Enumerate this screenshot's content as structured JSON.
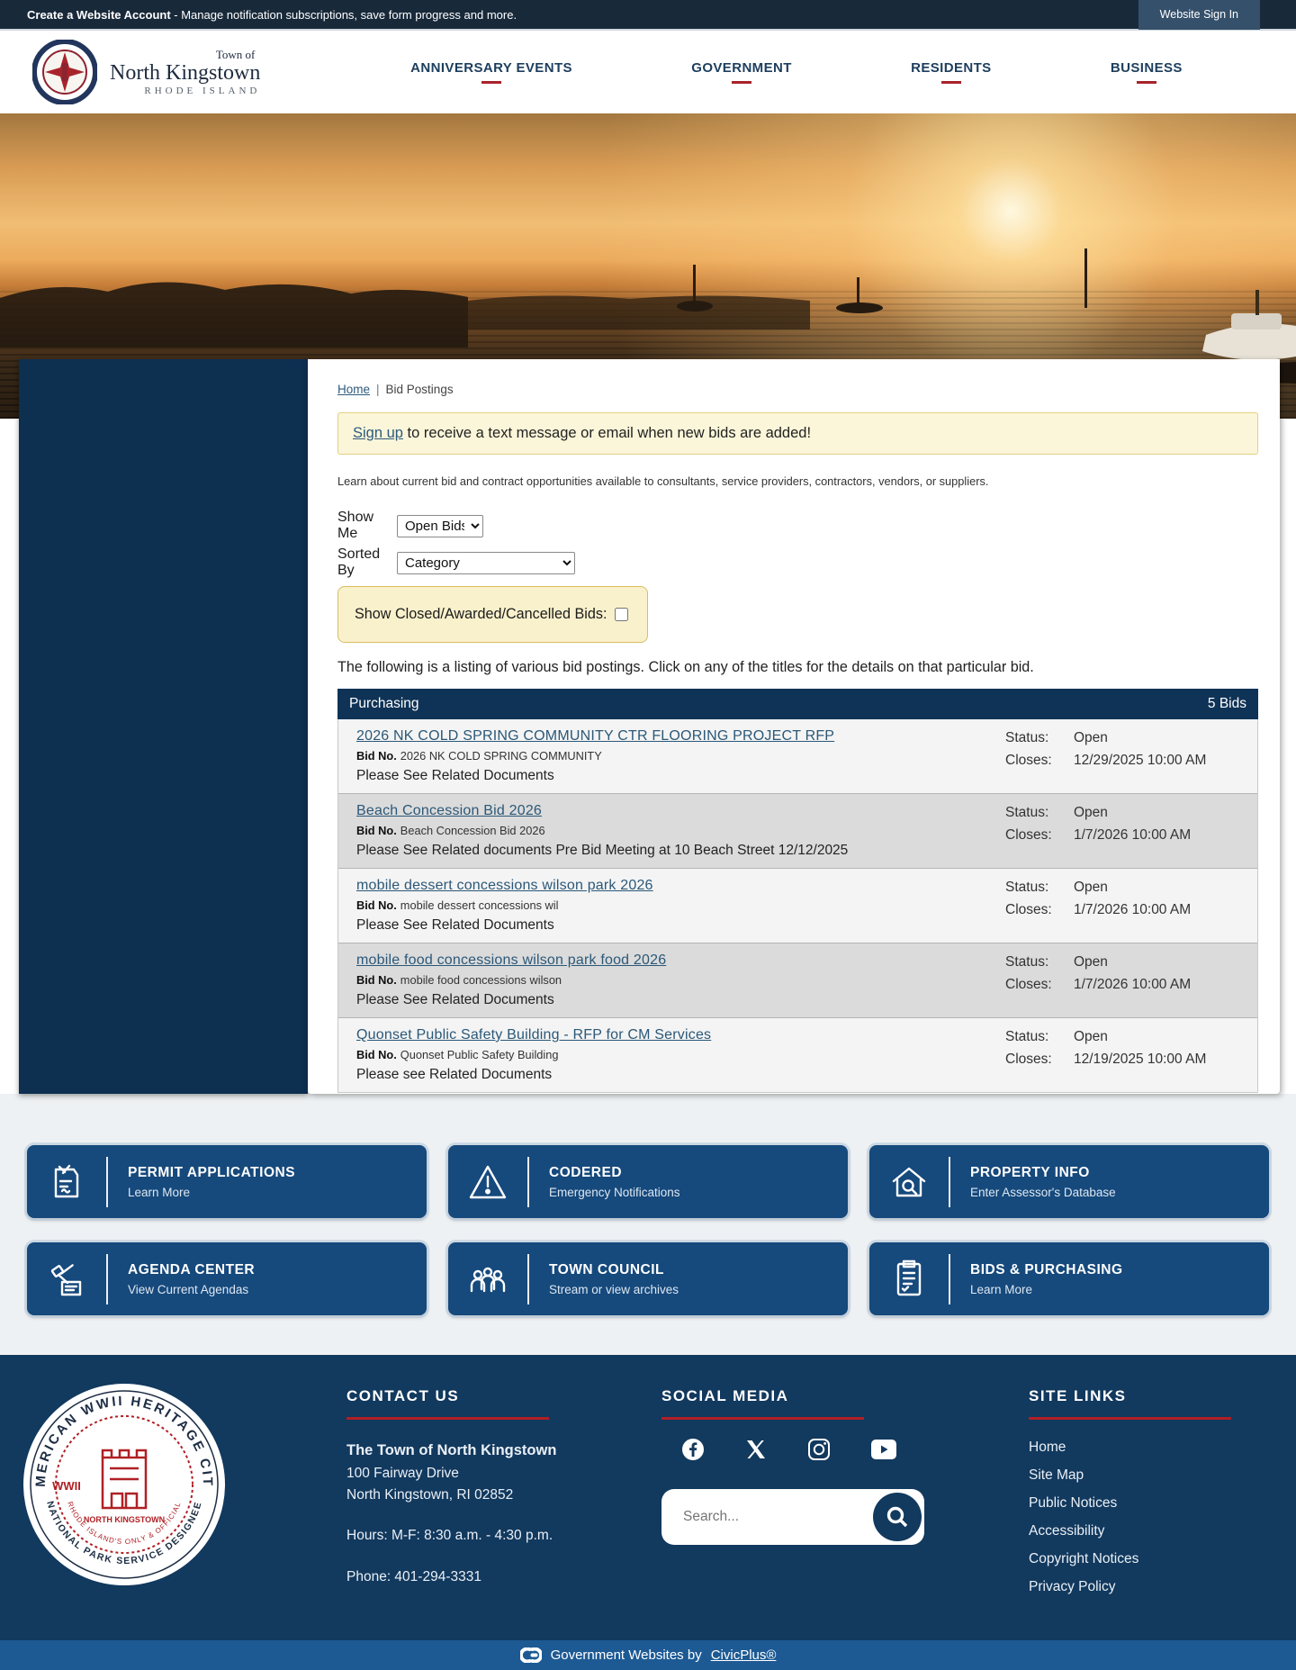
{
  "colors": {
    "accent_red": "#b01f26",
    "footer_navy": "#12395e",
    "card_blue": "#16497c",
    "bottom_bar_blue": "#1d5a94",
    "table_header_navy": "#0f3356"
  },
  "topbar": {
    "account_bold": "Create a Website Account",
    "account_rest": " - Manage notification subscriptions, save form progress and more.",
    "signin_label": "Website Sign In"
  },
  "header": {
    "logo": {
      "prefix": "Town of",
      "name": "North Kingstown",
      "state": "RHODE ISLAND"
    },
    "nav": [
      "ANNIVERSARY EVENTS",
      "GOVERNMENT",
      "RESIDENTS",
      "BUSINESS"
    ]
  },
  "breadcrumb": {
    "home": "Home",
    "separator": "|",
    "current": "Bid Postings"
  },
  "main": {
    "notice_link": "Sign up",
    "notice_rest": " to receive a text message or email when new bids are added!",
    "intro": "Learn about current bid and contract opportunities available to consultants, service providers, contractors, vendors, or suppliers.",
    "filters": {
      "show_me_label": "Show Me",
      "show_me_value": "Open Bids",
      "sorted_by_label": "Sorted By",
      "sorted_by_value": "Category",
      "closed_label": "Show Closed/Awarded/Cancelled Bids:"
    },
    "listing_intro": "The following is a listing of various bid postings. Click on any of the titles for the details on that particular bid.",
    "table": {
      "category": "Purchasing",
      "count": "5 Bids",
      "bid_no_label": "Bid No.",
      "status_label": "Status:",
      "closes_label": "Closes:",
      "rows": [
        {
          "title": "2026 NK COLD SPRING COMMUNITY CTR FLOORING PROJECT RFP",
          "bid_no": "2026 NK COLD SPRING COMMUNITY",
          "desc": "Please See Related Documents",
          "status": "Open",
          "closes": "12/29/2025 10:00 AM"
        },
        {
          "title": "Beach Concession Bid 2026",
          "bid_no": "Beach Concession Bid 2026",
          "desc": "Please See Related documents Pre Bid Meeting at 10 Beach Street 12/12/2025",
          "status": "Open",
          "closes": "1/7/2026 10:00 AM"
        },
        {
          "title": "mobile dessert concessions wilson park 2026",
          "bid_no": "mobile dessert concessions wil",
          "desc": "Please See Related Documents",
          "status": "Open",
          "closes": "1/7/2026 10:00 AM"
        },
        {
          "title": "mobile food concessions wilson park food 2026",
          "bid_no": "mobile food concessions wilson",
          "desc": "Please See Related Documents",
          "status": "Open",
          "closes": "1/7/2026 10:00 AM"
        },
        {
          "title": "Quonset Public Safety Building - RFP for CM Services",
          "bid_no": "Quonset Public Safety Building",
          "desc": "Please see Related Documents",
          "status": "Open",
          "closes": "12/19/2025 10:00 AM"
        }
      ]
    }
  },
  "quicklinks": [
    {
      "title": "PERMIT APPLICATIONS",
      "subtitle": "Learn More"
    },
    {
      "title": "CODERED",
      "subtitle": "Emergency Notifications"
    },
    {
      "title": "PROPERTY INFO",
      "subtitle": "Enter Assessor's Database"
    },
    {
      "title": "AGENDA CENTER",
      "subtitle": "View Current Agendas"
    },
    {
      "title": "TOWN COUNCIL",
      "subtitle": "Stream or view archives"
    },
    {
      "title": "BIDS & PURCHASING",
      "subtitle": "Learn More"
    }
  ],
  "footer": {
    "seal": {
      "arc_top": "AMERICAN WWII HERITAGE CITY",
      "arc_bottom_outer": "NATIONAL PARK SERVICE DESIGNEE",
      "arc_bottom_inner": "RHODE ISLAND'S ONLY & OFFICIAL",
      "wwii": "WWII",
      "crest": "NORTH KINGSTOWN"
    },
    "contact": {
      "heading": "CONTACT US",
      "org": "The Town of North Kingstown",
      "addr1": "100 Fairway Drive",
      "addr2": "North Kingstown, RI 02852",
      "hours": "Hours: M-F: 8:30 a.m. - 4:30 p.m.",
      "phone": "Phone: 401-294-3331"
    },
    "social": {
      "heading": "SOCIAL MEDIA"
    },
    "search_placeholder": "Search...",
    "sitelinks": {
      "heading": "SITE LINKS",
      "links": [
        "Home",
        "Site Map",
        "Public Notices",
        "Accessibility",
        "Copyright Notices",
        "Privacy Policy"
      ]
    }
  },
  "bottombar": {
    "text": "Government Websites by",
    "link": "CivicPlus®"
  }
}
